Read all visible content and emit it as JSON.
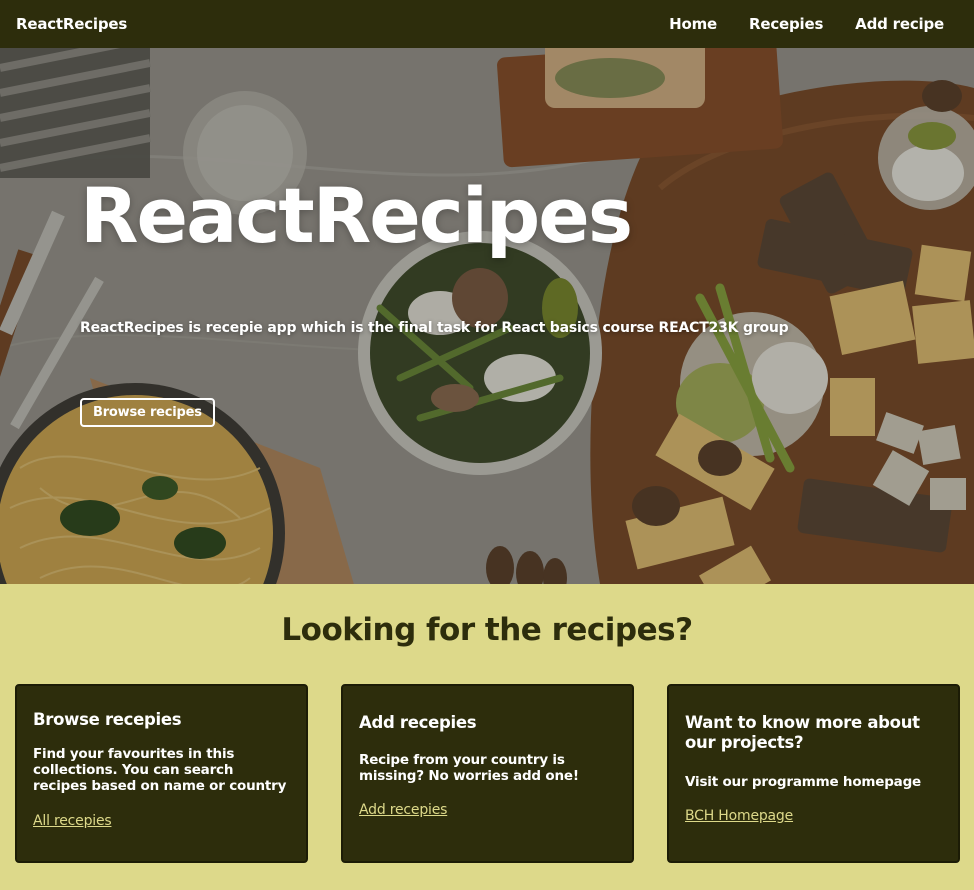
{
  "navbar": {
    "brand": "ReactRecipes",
    "links": [
      {
        "label": "Home"
      },
      {
        "label": "Recepies"
      },
      {
        "label": "Add recipe"
      }
    ]
  },
  "hero": {
    "title": "ReactRecipes",
    "subtitle": "ReactRecipes is recepie app which is the final task for React basics course REACT23K group",
    "button_label": "Browse recipes"
  },
  "section": {
    "title": "Looking for the recipes?",
    "cards": [
      {
        "title": "Browse recepies",
        "text": "Find your favourites in this collections. You can search recipes based on name or country",
        "link": "All recepies"
      },
      {
        "title": "Add recepies",
        "text": "Recipe from your country is missing? No worries add one!",
        "link": "Add recepies"
      },
      {
        "title": "Want to know more about our projects?",
        "text": "Visit our programme homepage",
        "link": "BCH Homepage"
      }
    ]
  },
  "colors": {
    "navbar_bg": "#2d2d0c",
    "section_bg": "#ddd98a",
    "card_bg": "#2d2d0c",
    "link": "#ddd98a"
  }
}
